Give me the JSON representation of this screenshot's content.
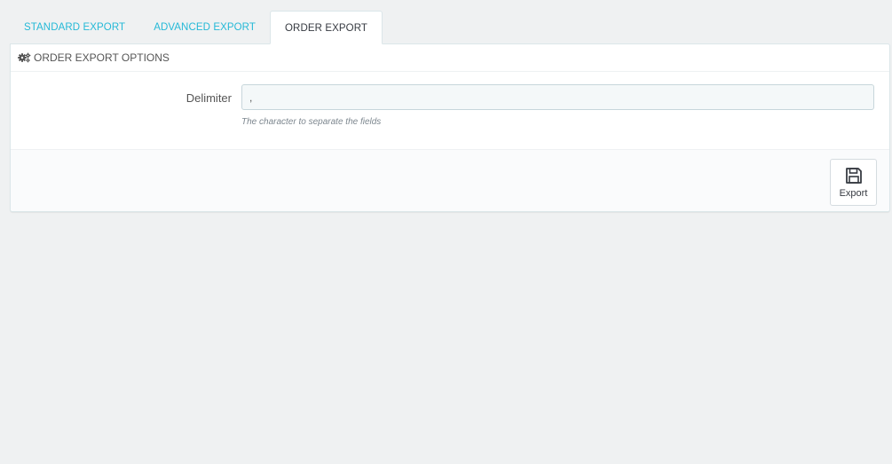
{
  "tabs": [
    {
      "label": "STANDARD EXPORT",
      "active": false
    },
    {
      "label": "ADVANCED EXPORT",
      "active": false
    },
    {
      "label": "ORDER EXPORT",
      "active": true
    }
  ],
  "panel": {
    "title": "ORDER EXPORT OPTIONS",
    "icon": "cogs-icon",
    "delimiter": {
      "label": "Delimiter",
      "value": ",",
      "help": "The character to separate the fields"
    },
    "footer": {
      "export_label": "Export",
      "export_icon": "save-icon"
    }
  },
  "colors": {
    "accent": "#25b9d7",
    "background": "#eff1f2"
  }
}
